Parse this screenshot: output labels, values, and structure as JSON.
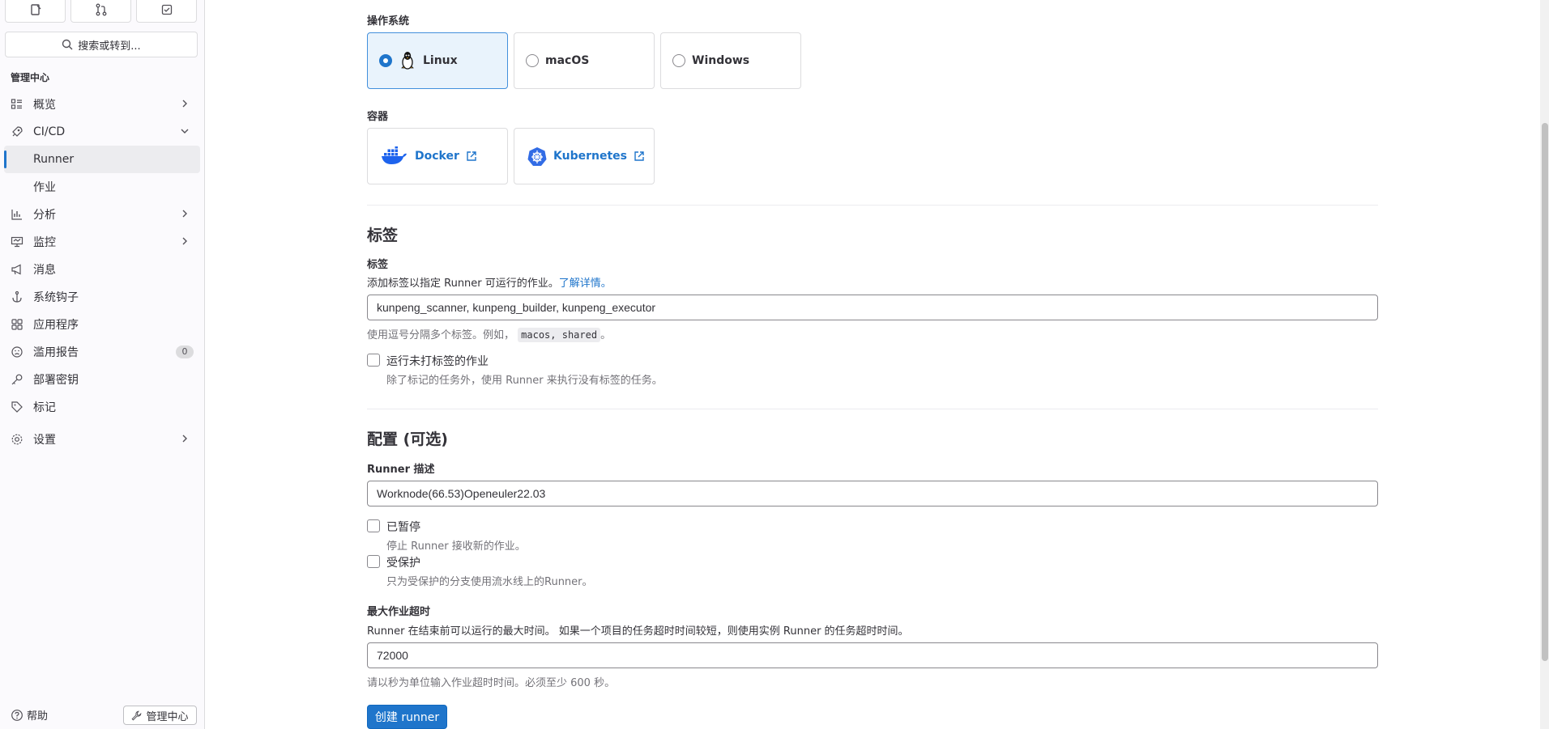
{
  "sidebar": {
    "search_label": "搜索或转到...",
    "section_title": "管理中心",
    "items": [
      {
        "label": "概览"
      },
      {
        "label": "CI/CD"
      },
      {
        "label": "分析"
      },
      {
        "label": "监控"
      },
      {
        "label": "消息"
      },
      {
        "label": "系统钩子"
      },
      {
        "label": "应用程序"
      },
      {
        "label": "滥用报告",
        "badge": "0"
      },
      {
        "label": "部署密钥"
      },
      {
        "label": "标记"
      },
      {
        "label": "设置"
      }
    ],
    "cicd_sub": [
      {
        "label": "Runner"
      },
      {
        "label": "作业"
      }
    ],
    "help_label": "帮助",
    "admin_label": "管理中心"
  },
  "os": {
    "label": "操作系统",
    "options": [
      {
        "label": "Linux"
      },
      {
        "label": "macOS"
      },
      {
        "label": "Windows"
      }
    ]
  },
  "containers": {
    "label": "容器",
    "options": [
      {
        "label": "Docker"
      },
      {
        "label": "Kubernetes"
      }
    ]
  },
  "tags": {
    "heading": "标签",
    "label": "标签",
    "help": "添加标签以指定 Runner 可运行的作业。",
    "help_link": "了解详情。",
    "value": "kunpeng_scanner, kunpeng_builder, kunpeng_executor",
    "hint_prefix": "使用逗号分隔多个标签。例如，",
    "hint_code": "macos, shared",
    "hint_suffix": "。",
    "untagged_label": "运行未打标签的作业",
    "untagged_help": "除了标记的任务外，使用 Runner 来执行没有标签的任务。"
  },
  "config": {
    "heading": "配置 (可选)",
    "desc_label": "Runner 描述",
    "desc_value": "Worknode(66.53)Openeuler22.03",
    "paused_label": "已暂停",
    "paused_help": "停止 Runner 接收新的作业。",
    "protected_label": "受保护",
    "protected_help": "只为受保护的分支使用流水线上的Runner。",
    "timeout_label": "最大作业超时",
    "timeout_help": "Runner 在结束前可以运行的最大时间。 如果一个项目的任务超时时间较短，则使用实例 Runner 的任务超时时间。",
    "timeout_value": "72000",
    "timeout_hint": "请以秒为单位输入作业超时时间。必须至少 600 秒。",
    "submit_label": "创建 runner"
  }
}
